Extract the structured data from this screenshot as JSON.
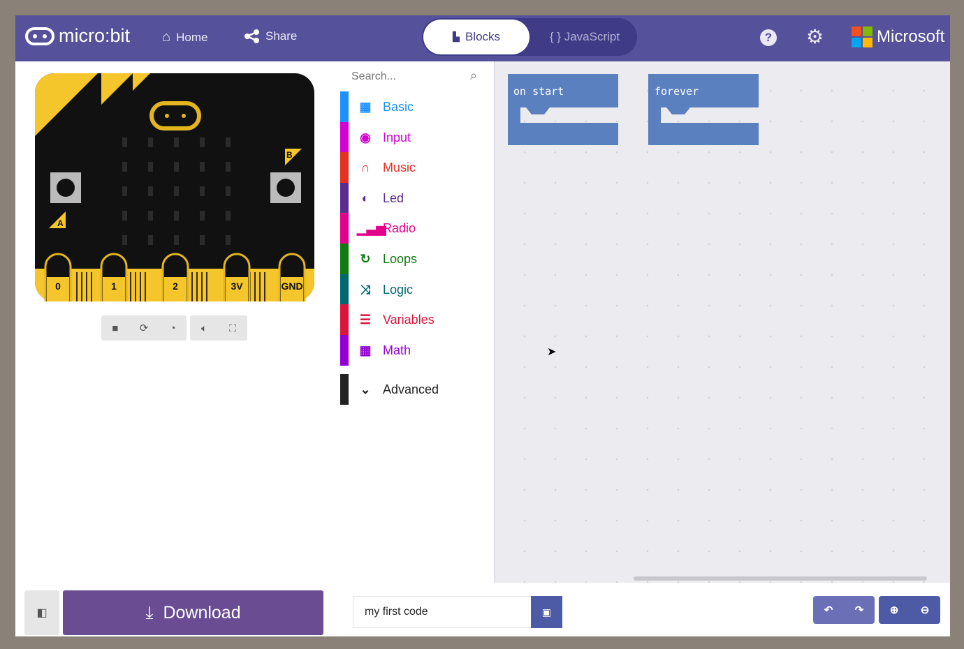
{
  "header": {
    "brand": "micro:bit",
    "home": "Home",
    "share": "Share",
    "tabs": [
      {
        "label": "Blocks",
        "active": true
      },
      {
        "label": "{ } JavaScript",
        "active": false
      }
    ],
    "microsoft": "Microsoft",
    "color": "#55519a",
    "icons": [
      "help-icon",
      "settings-icon"
    ]
  },
  "simulator": {
    "pins": [
      "0",
      "1",
      "2",
      "3V",
      "GND"
    ],
    "button_a": "A",
    "button_b": "B",
    "controls": [
      "stop-icon",
      "restart-icon",
      "slow-mo-icon",
      "mute-icon",
      "fullscreen-icon"
    ]
  },
  "toolbox": {
    "search_placeholder": "Search...",
    "categories": [
      {
        "label": "Basic",
        "color": "#1e90ff",
        "icon": "grid-icon"
      },
      {
        "label": "Input",
        "color": "#d400d4",
        "icon": "target-icon"
      },
      {
        "label": "Music",
        "color": "#e63022",
        "icon": "headphones-icon"
      },
      {
        "label": "Led",
        "color": "#5c2d91",
        "icon": "toggle-icon"
      },
      {
        "label": "Radio",
        "color": "#e3008c",
        "icon": "signal-icon"
      },
      {
        "label": "Loops",
        "color": "#107c10",
        "icon": "refresh-icon"
      },
      {
        "label": "Logic",
        "color": "#006970",
        "icon": "shuffle-icon"
      },
      {
        "label": "Variables",
        "color": "#dc143c",
        "icon": "list-icon"
      },
      {
        "label": "Math",
        "color": "#9400d3",
        "icon": "calculator-icon"
      }
    ],
    "advanced": {
      "label": "Advanced",
      "color": "#222222"
    }
  },
  "workspace": {
    "blocks": [
      {
        "label": "on start"
      },
      {
        "label": "forever"
      }
    ],
    "block_color": "#5b80c0"
  },
  "footer": {
    "download": "Download",
    "project_name": "my first code",
    "download_color": "#6a4c93"
  }
}
